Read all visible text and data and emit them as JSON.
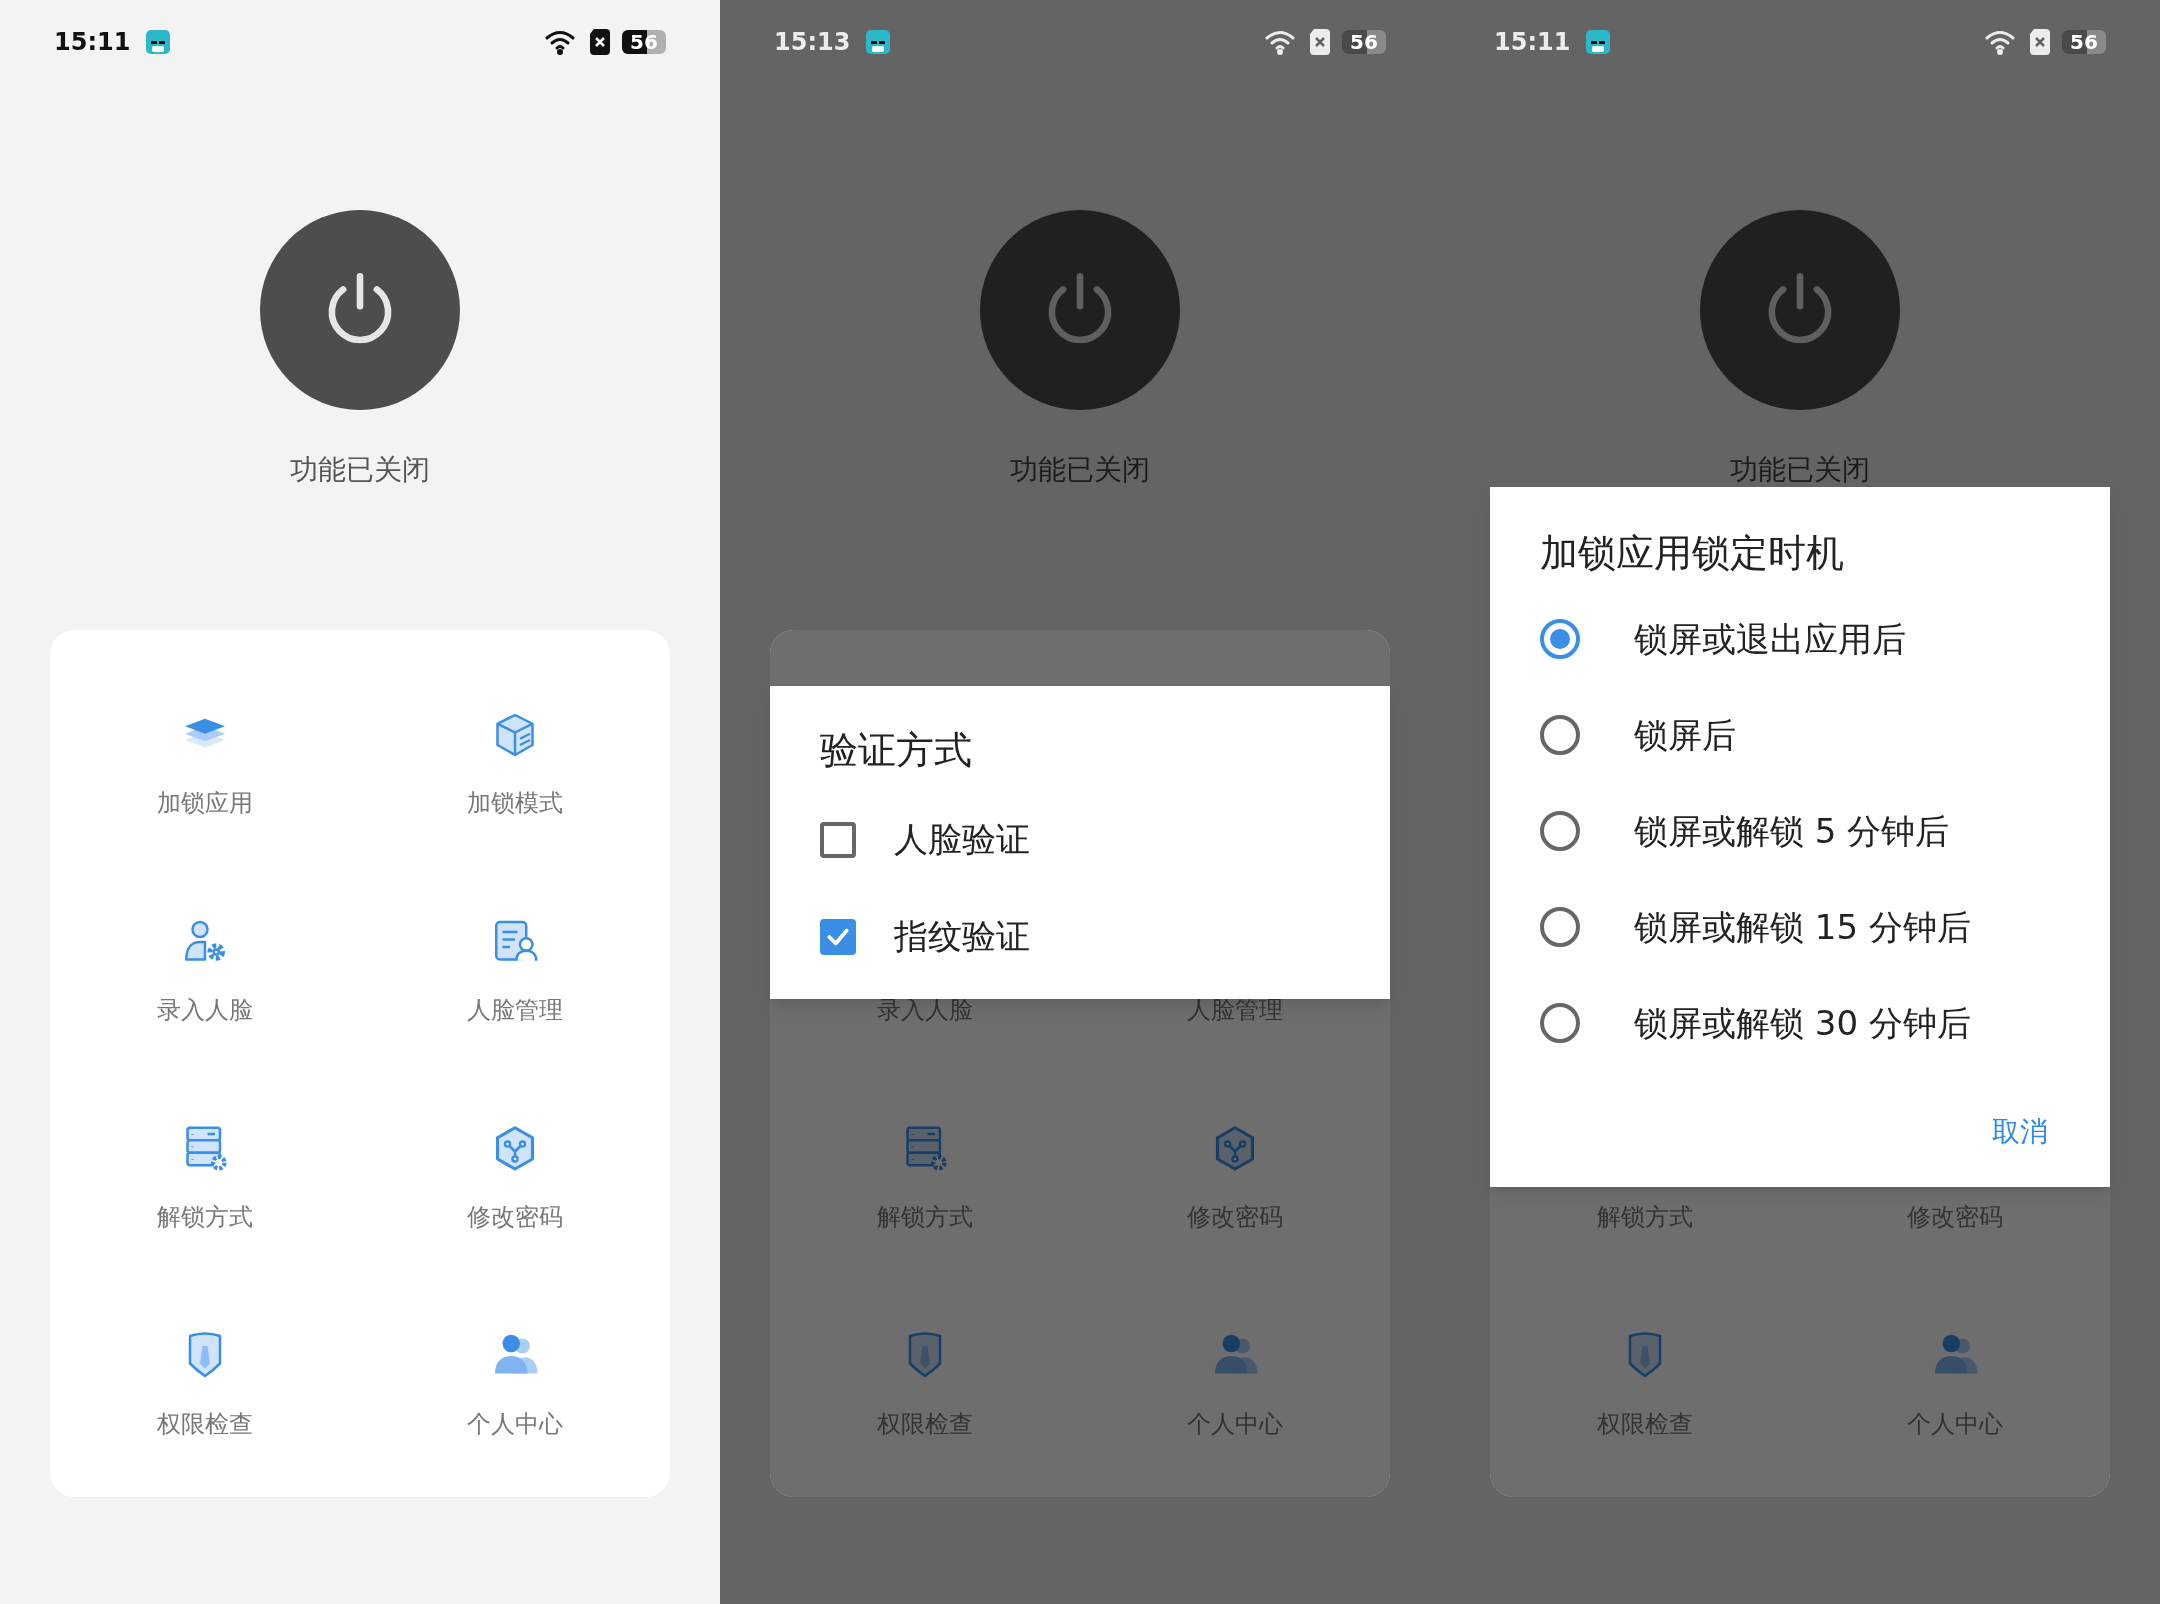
{
  "screens": [
    {
      "dimmed": false,
      "status_bar": {
        "time": "15:11",
        "battery": "56"
      },
      "power": {
        "on": false,
        "label": "功能已关闭"
      },
      "grid": [
        {
          "kind": "tile",
          "label": "加锁应用"
        },
        {
          "kind": "tile",
          "label": "加锁模式"
        },
        {
          "kind": "tile",
          "label": "录入人脸"
        },
        {
          "kind": "tile",
          "label": "人脸管理"
        },
        {
          "kind": "tile",
          "label": "解锁方式"
        },
        {
          "kind": "tile",
          "label": "修改密码"
        },
        {
          "kind": "tile",
          "label": "权限检查"
        },
        {
          "kind": "tile",
          "label": "个人中心"
        }
      ]
    },
    {
      "dimmed": true,
      "status_bar": {
        "time": "15:13",
        "battery": "56"
      },
      "power": {
        "on": false,
        "label": "功能已关闭"
      },
      "grid": [
        {
          "kind": "label",
          "label": "录入人脸"
        },
        {
          "kind": "label",
          "label": "人脸管理"
        },
        {
          "kind": "tile",
          "label": "解锁方式"
        },
        {
          "kind": "tile",
          "label": "修改密码"
        },
        {
          "kind": "tile",
          "label": "权限检查"
        },
        {
          "kind": "tile",
          "label": "个人中心"
        }
      ],
      "dialog": {
        "kind": "checkbox",
        "title": "验证方式",
        "options": [
          {
            "label": "人脸验证",
            "checked": false
          },
          {
            "label": "指纹验证",
            "checked": true
          }
        ]
      }
    },
    {
      "dimmed": true,
      "status_bar": {
        "time": "15:11",
        "battery": "56"
      },
      "power": {
        "on": false,
        "label": "功能已关闭"
      },
      "grid": [
        {
          "kind": "label",
          "label": "解锁方式"
        },
        {
          "kind": "label",
          "label": "修改密码"
        },
        {
          "kind": "tile",
          "label": "权限检查"
        },
        {
          "kind": "tile",
          "label": "个人中心"
        }
      ],
      "dialog": {
        "kind": "radio",
        "title": "加锁应用锁定时机",
        "options": [
          {
            "label": "锁屏或退出应用后",
            "selected": true
          },
          {
            "label": "锁屏后",
            "selected": false
          },
          {
            "label": "锁屏或解锁 5 分钟后",
            "selected": false
          },
          {
            "label": "锁屏或解锁 15 分钟后",
            "selected": false
          },
          {
            "label": "锁屏或解锁 30 分钟后",
            "selected": false
          }
        ],
        "buttons": [
          "取消"
        ]
      }
    }
  ]
}
